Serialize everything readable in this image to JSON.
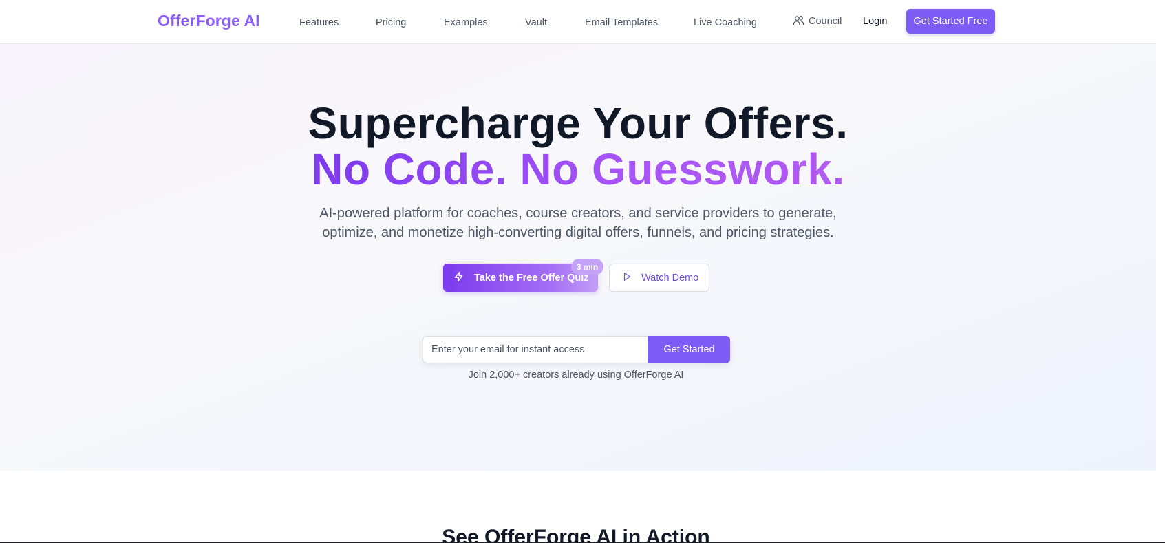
{
  "nav": {
    "logo": "OfferForge AI",
    "links": [
      "Features",
      "Pricing",
      "Examples",
      "Vault",
      "Email Templates",
      "Live Coaching"
    ],
    "council_label": "Council",
    "council_icon": "users-icon",
    "login_label": "Login",
    "cta_label": "Get Started Free"
  },
  "hero": {
    "headline_line1": "Supercharge Your Offers.",
    "headline_line2": "No Code. No Guesswork.",
    "subtitle": "AI-powered platform for coaches, course creators, and service providers to generate, optimize, and monetize high-converting digital offers, funnels, and pricing strategies.",
    "quiz_button_label": "Take the Free Offer Quiz",
    "quiz_button_icon": "lightning-icon",
    "quiz_badge": "3 min",
    "demo_button_label": "Watch Demo",
    "demo_button_icon": "play-icon",
    "email_placeholder": "Enter your email for instant access",
    "email_button_label": "Get Started",
    "social_proof": "Join 2,000+ creators already using OfferForge AI"
  },
  "next_section": {
    "title": "See OfferForge AI in Action"
  },
  "colors": {
    "brand": "#7c5cf5",
    "accent_purple": "#8b5cf6",
    "headline_dark": "#111827"
  }
}
